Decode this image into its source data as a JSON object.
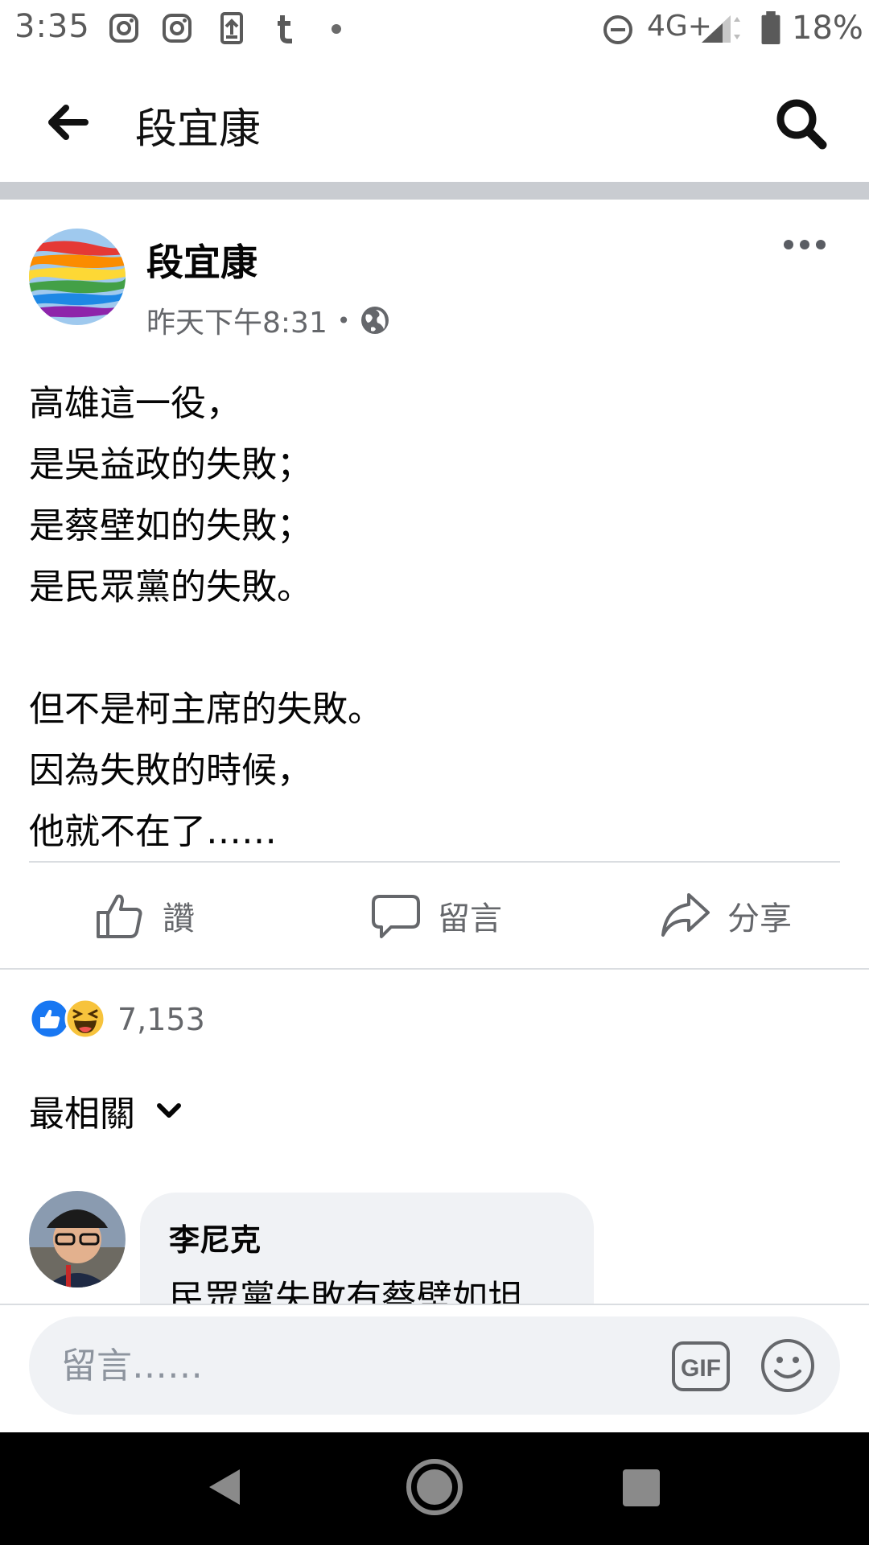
{
  "status_bar": {
    "time": "3:35",
    "network": "4G+",
    "battery": "18%",
    "notification_icons": [
      "instagram-icon",
      "instagram-icon",
      "upload-icon",
      "tumblr-icon"
    ]
  },
  "header": {
    "title": "段宜康",
    "back_icon": "back-arrow-icon",
    "search_icon": "search-icon"
  },
  "post": {
    "author": "段宜康",
    "timestamp": "昨天下午8:31",
    "separator": "•",
    "privacy_icon": "globe-icon",
    "body_lines": [
      "高雄這一役，",
      "是吳益政的失敗；",
      "是蔡壁如的失敗；",
      "是民眾黨的失敗。",
      "",
      "但不是柯主席的失敗。",
      "因為失敗的時候，",
      "他就不在了……"
    ]
  },
  "actions": {
    "like": "讚",
    "comment": "留言",
    "share": "分享"
  },
  "reactions": {
    "count": "7,153",
    "types": [
      "like",
      "haha"
    ]
  },
  "comments": {
    "sort_label": "最相關",
    "items": [
      {
        "author": "李尼克",
        "text": "民眾黨失敗有蔡壁如坦"
      }
    ]
  },
  "composer": {
    "placeholder": "留言……",
    "gif_label": "GIF"
  },
  "colors": {
    "text_primary": "#050505",
    "text_secondary": "#65676b",
    "divider": "#c9ccd1",
    "bubble": "#f0f2f5",
    "like_blue": "#1877f2"
  }
}
